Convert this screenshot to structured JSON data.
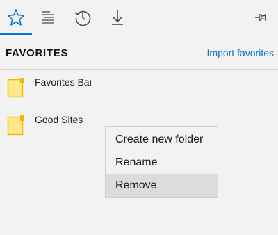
{
  "toolbar": {
    "tabs": [
      {
        "icon": "star-icon",
        "name": "favorites"
      },
      {
        "icon": "reading-list-icon",
        "name": "reading-list"
      },
      {
        "icon": "history-icon",
        "name": "history"
      },
      {
        "icon": "download-icon",
        "name": "downloads"
      }
    ],
    "pin_icon": "pin-icon",
    "accent_color": "#0078d7"
  },
  "header": {
    "title": "FAVORITES",
    "import_link": "Import favorites"
  },
  "favorites": [
    {
      "label": "Favorites Bar",
      "icon": "folder-icon"
    },
    {
      "label": "Good Sites",
      "icon": "folder-icon"
    }
  ],
  "context_menu": {
    "items": [
      {
        "label": "Create new folder"
      },
      {
        "label": "Rename"
      },
      {
        "label": "Remove",
        "highlighted": true
      }
    ]
  }
}
